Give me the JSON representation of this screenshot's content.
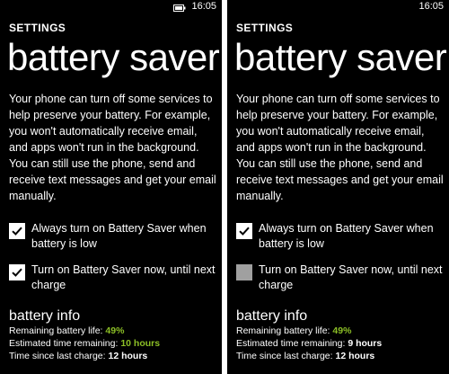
{
  "status_bar": {
    "time": "16:05"
  },
  "settings_label": "SETTINGS",
  "page_title": "battery saver",
  "description": {
    "para1": "Your phone can turn off some services to help preserve your battery. For example, you won't automatically receive email, and apps won't run in the background.",
    "para2": "You can still use the phone, send and receive text messages and get your email manually."
  },
  "option_always": {
    "label": "Always turn on Battery Saver when battery is low"
  },
  "option_now": {
    "label": "Turn on Battery Saver now, until next charge"
  },
  "battery_info": {
    "title": "battery info",
    "remaining_label": "Remaining battery life: ",
    "time_label": "Estimated time remaining: ",
    "since_label": "Time since last charge: "
  },
  "screens": [
    {
      "option_always_checked": true,
      "option_now_checked": true,
      "remaining_value": "49%",
      "time_value": "10 hours",
      "time_value_color": "#8cbf26",
      "since_value": "12 hours"
    },
    {
      "option_always_checked": true,
      "option_now_checked": false,
      "remaining_value": "49%",
      "time_value": "9 hours",
      "time_value_color": "#ffffff",
      "since_value": "12 hours"
    }
  ],
  "colors": {
    "accent": "#8cbf26",
    "background": "#000000",
    "text": "#ffffff",
    "unchecked_box": "#a0a0a0"
  }
}
